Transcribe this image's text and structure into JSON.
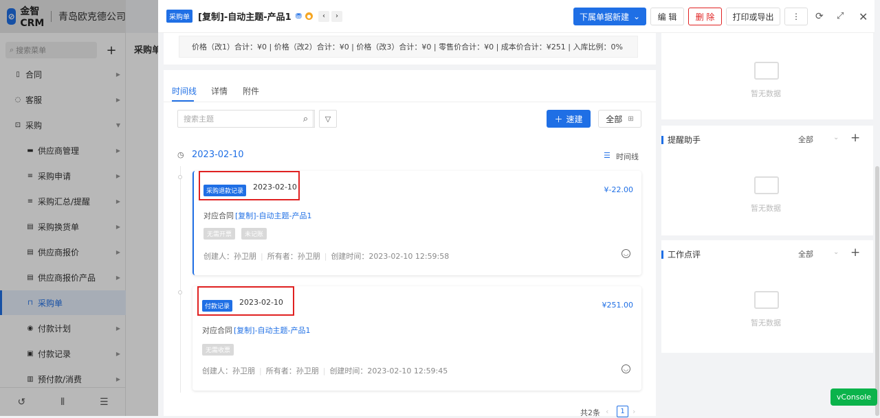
{
  "brand": {
    "logo": "金智CRM",
    "company": "青岛欧克德公司"
  },
  "sidebar": {
    "search_placeholder": "搜索菜单",
    "items": [
      {
        "label": "合同",
        "icon": "contract-icon",
        "level": 1
      },
      {
        "label": "客服",
        "icon": "headset-icon",
        "level": 1
      },
      {
        "label": "采购",
        "icon": "cart-icon",
        "level": 1
      },
      {
        "label": "供应商管理",
        "icon": "folder-icon",
        "level": 2
      },
      {
        "label": "采购申请",
        "icon": "list-icon",
        "level": 2
      },
      {
        "label": "采购汇总/提醒",
        "icon": "list-icon",
        "level": 2
      },
      {
        "label": "采购换货单",
        "icon": "doc-icon",
        "level": 2
      },
      {
        "label": "供应商报价",
        "icon": "doc-icon",
        "level": 2
      },
      {
        "label": "供应商报价产品",
        "icon": "doc-icon",
        "level": 2
      },
      {
        "label": "采购单",
        "icon": "bag-icon",
        "level": 2,
        "active": true
      },
      {
        "label": "付款计划",
        "icon": "plan-icon",
        "level": 2
      },
      {
        "label": "付款记录",
        "icon": "record-icon",
        "level": 2
      },
      {
        "label": "预付款/消费",
        "icon": "prepay-icon",
        "level": 2
      }
    ],
    "bottom_icons": [
      "history-icon",
      "settings-sliders-icon",
      "menu-collapse-icon"
    ]
  },
  "background_page": {
    "title": "采购单"
  },
  "drawer": {
    "badge": "采购单",
    "title": "[复制]-自动主题-产品1",
    "actions": {
      "sub_new": "下属单据新建",
      "edit": "编 辑",
      "delete": "删 除",
      "print": "打印或导出",
      "more": "⋮"
    },
    "summary": "价格（改1）合计：¥0 |   价格（改2）合计：¥0 |   价格（改3）合计：¥0 |   零售价合计：¥0 |   成本价合计：¥251 |   入库比例：0%",
    "tabs": [
      "时间线",
      "详情",
      "附件"
    ],
    "search_placeholder": "搜索主题",
    "quick_btn": "速建",
    "all_btn": "全部",
    "date_group": "2023-02-10",
    "timeline_toggle": "时间线",
    "records": [
      {
        "badge": "采购退款记录",
        "date": "2023-02-10",
        "amount": "¥-22.00",
        "contract_label": "对应合同",
        "contract_link": "[复制]-自动主题-产品1",
        "tags": [
          "无需开票",
          "未记账"
        ],
        "creator": "创建人：孙卫朋",
        "owner": "所有者：孙卫朋",
        "created": "创建时间：2023-02-10 12:59:58"
      },
      {
        "badge": "付款记录",
        "date": "2023-02-10",
        "amount": "¥251.00",
        "contract_label": "对应合同",
        "contract_link": "[复制]-自动主题-产品1",
        "tags": [
          "无需收票"
        ],
        "creator": "创建人：孙卫朋",
        "owner": "所有者：孙卫朋",
        "created": "创建时间：2023-02-10 12:59:45"
      }
    ],
    "pagination": {
      "total": "共2条",
      "current": "1"
    }
  },
  "right_panels": [
    {
      "title": "",
      "empty": "暂无数据"
    },
    {
      "title": "提醒助手",
      "filter": "全部",
      "empty": "暂无数据"
    },
    {
      "title": "工作点评",
      "filter": "全部",
      "empty": "暂无数据"
    }
  ],
  "vconsole": "vConsole",
  "colors": {
    "primary": "#1f6fe5",
    "danger": "#e02020",
    "vconsole": "#0bb34b"
  }
}
